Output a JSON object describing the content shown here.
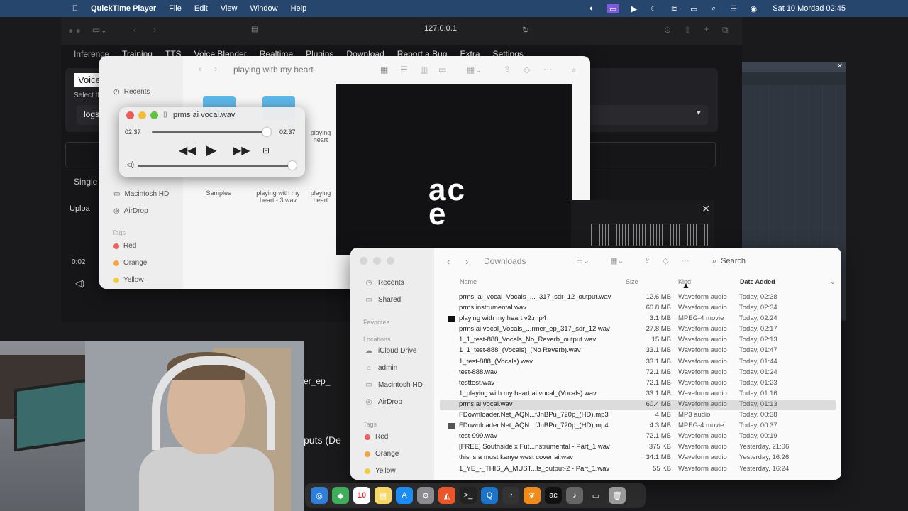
{
  "menubar": {
    "app": "QuickTime Player",
    "menus": [
      "File",
      "Edit",
      "View",
      "Window",
      "Help"
    ],
    "clock": "Sat 10 Mordad  02:45"
  },
  "browser": {
    "url": "127.0.0.1",
    "tabs": [
      "Inference",
      "Training",
      "TTS",
      "Voice Blender",
      "Realtime",
      "Plugins",
      "Download",
      "Report a Bug",
      "Extra",
      "Settings"
    ],
    "voice_label": "Voice",
    "select_text": "Select th",
    "logs_text": "logs/",
    "single_label": "Single",
    "upload_label": "Uploa",
    "time_label": "0:02",
    "partial_text_1": "er_ep_",
    "partial_text_2": "puts (De"
  },
  "finder_back": {
    "title": "playing with my heart",
    "sidebar": {
      "items": [
        "Recents",
        "Macintosh HD",
        "AirDrop"
      ],
      "tags_heading": "Tags",
      "tags": [
        {
          "label": "Red",
          "color": "#ec5f5f"
        },
        {
          "label": "Orange",
          "color": "#f3a443"
        },
        {
          "label": "Yellow",
          "color": "#f1cc3f"
        }
      ]
    },
    "files": [
      "Samples",
      "playing with my heart - 3.wav",
      "playing heart",
      "playing heart"
    ]
  },
  "quicktime": {
    "title": "prms ai vocal.wav",
    "current_time": "02:37",
    "remaining_time": "02:37",
    "progress": 1.0,
    "volume": 1.0
  },
  "downloads": {
    "title": "Downloads",
    "search_placeholder": "Search",
    "sidebar": {
      "items_top": [
        "Recents",
        "Shared"
      ],
      "favorites_heading": "Favorites",
      "locations_heading": "Locations",
      "locations": [
        "iCloud Drive",
        "admin",
        "Macintosh HD",
        "AirDrop"
      ],
      "tags_heading": "Tags",
      "tags": [
        {
          "label": "Red",
          "color": "#ec5f5f"
        },
        {
          "label": "Orange",
          "color": "#f3a443"
        },
        {
          "label": "Yellow",
          "color": "#f1cc3f"
        }
      ]
    },
    "columns": {
      "name": "Name",
      "size": "Size",
      "kind": "Kind",
      "date": "Date Added"
    },
    "rows": [
      {
        "name": "prms_ai_vocal_Vocals_..._317_sdr_12_output.wav",
        "size": "12.6 MB",
        "kind": "Waveform audio",
        "date": "Today, 02:38",
        "icon": "none"
      },
      {
        "name": "prms instrumental.wav",
        "size": "60.8 MB",
        "kind": "Waveform audio",
        "date": "Today, 02:34",
        "icon": "none"
      },
      {
        "name": "playing with my heart v2.mp4",
        "size": "3.1 MB",
        "kind": "MPEG-4 movie",
        "date": "Today, 02:24",
        "icon": "video"
      },
      {
        "name": "prms ai vocal_Vocals_...rmer_ep_317_sdr_12.wav",
        "size": "27.8 MB",
        "kind": "Waveform audio",
        "date": "Today, 02:17",
        "icon": "none"
      },
      {
        "name": "1_1_test-888_Vocals_No_Reverb_output.wav",
        "size": "15 MB",
        "kind": "Waveform audio",
        "date": "Today, 02:13",
        "icon": "none"
      },
      {
        "name": "1_1_test-888_(Vocals)_(No Reverb).wav",
        "size": "33.1 MB",
        "kind": "Waveform audio",
        "date": "Today, 01:47",
        "icon": "none"
      },
      {
        "name": "1_test-888_(Vocals).wav",
        "size": "33.1 MB",
        "kind": "Waveform audio",
        "date": "Today, 01:44",
        "icon": "none"
      },
      {
        "name": "test-888.wav",
        "size": "72.1 MB",
        "kind": "Waveform audio",
        "date": "Today, 01:24",
        "icon": "none"
      },
      {
        "name": "testtest.wav",
        "size": "72.1 MB",
        "kind": "Waveform audio",
        "date": "Today, 01:23",
        "icon": "none"
      },
      {
        "name": "1_playing with my heart ai vocal_(Vocals).wav",
        "size": "33.1 MB",
        "kind": "Waveform audio",
        "date": "Today, 01:16",
        "icon": "none"
      },
      {
        "name": "prms ai vocal.wav",
        "size": "60.4 MB",
        "kind": "Waveform audio",
        "date": "Today, 01:13",
        "icon": "none",
        "selected": true
      },
      {
        "name": "FDownloader.Net_AQN...fJnBPu_720p_(HD).mp3",
        "size": "4 MB",
        "kind": "MP3 audio",
        "date": "Today, 00:38",
        "icon": "none"
      },
      {
        "name": "FDownloader.Net_AQN...fJnBPu_720p_(HD).mp4",
        "size": "4.3 MB",
        "kind": "MPEG-4 movie",
        "date": "Today, 00:37",
        "icon": "thumb"
      },
      {
        "name": "test-999.wav",
        "size": "72.1 MB",
        "kind": "Waveform audio",
        "date": "Today, 00:19",
        "icon": "none"
      },
      {
        "name": "[FREE] Southside x Fut...nstrumental - Part_1.wav",
        "size": "375 KB",
        "kind": "Waveform audio",
        "date": "Yesterday, 21:06",
        "icon": "none"
      },
      {
        "name": "this is a must kanye west cover ai.wav",
        "size": "34.1 MB",
        "kind": "Waveform audio",
        "date": "Yesterday, 16:26",
        "icon": "none"
      },
      {
        "name": "1_YE_-_THIS_A_MUST...ls_output-2 - Part_1.wav",
        "size": "55 KB",
        "kind": "Waveform audio",
        "date": "Yesterday, 16:24",
        "icon": "none"
      }
    ]
  },
  "dock": {
    "calendar_day": "10",
    "items": [
      "safari-icon",
      "maps-icon",
      "calendar-icon",
      "notes-icon",
      "app-store-icon",
      "settings-icon",
      "brave-icon",
      "terminal-icon",
      "quicktime-icon",
      "activity-icon",
      "fl-studio-icon",
      "ace-icon",
      "music-icon",
      "screen-icon",
      "trash-icon"
    ]
  }
}
